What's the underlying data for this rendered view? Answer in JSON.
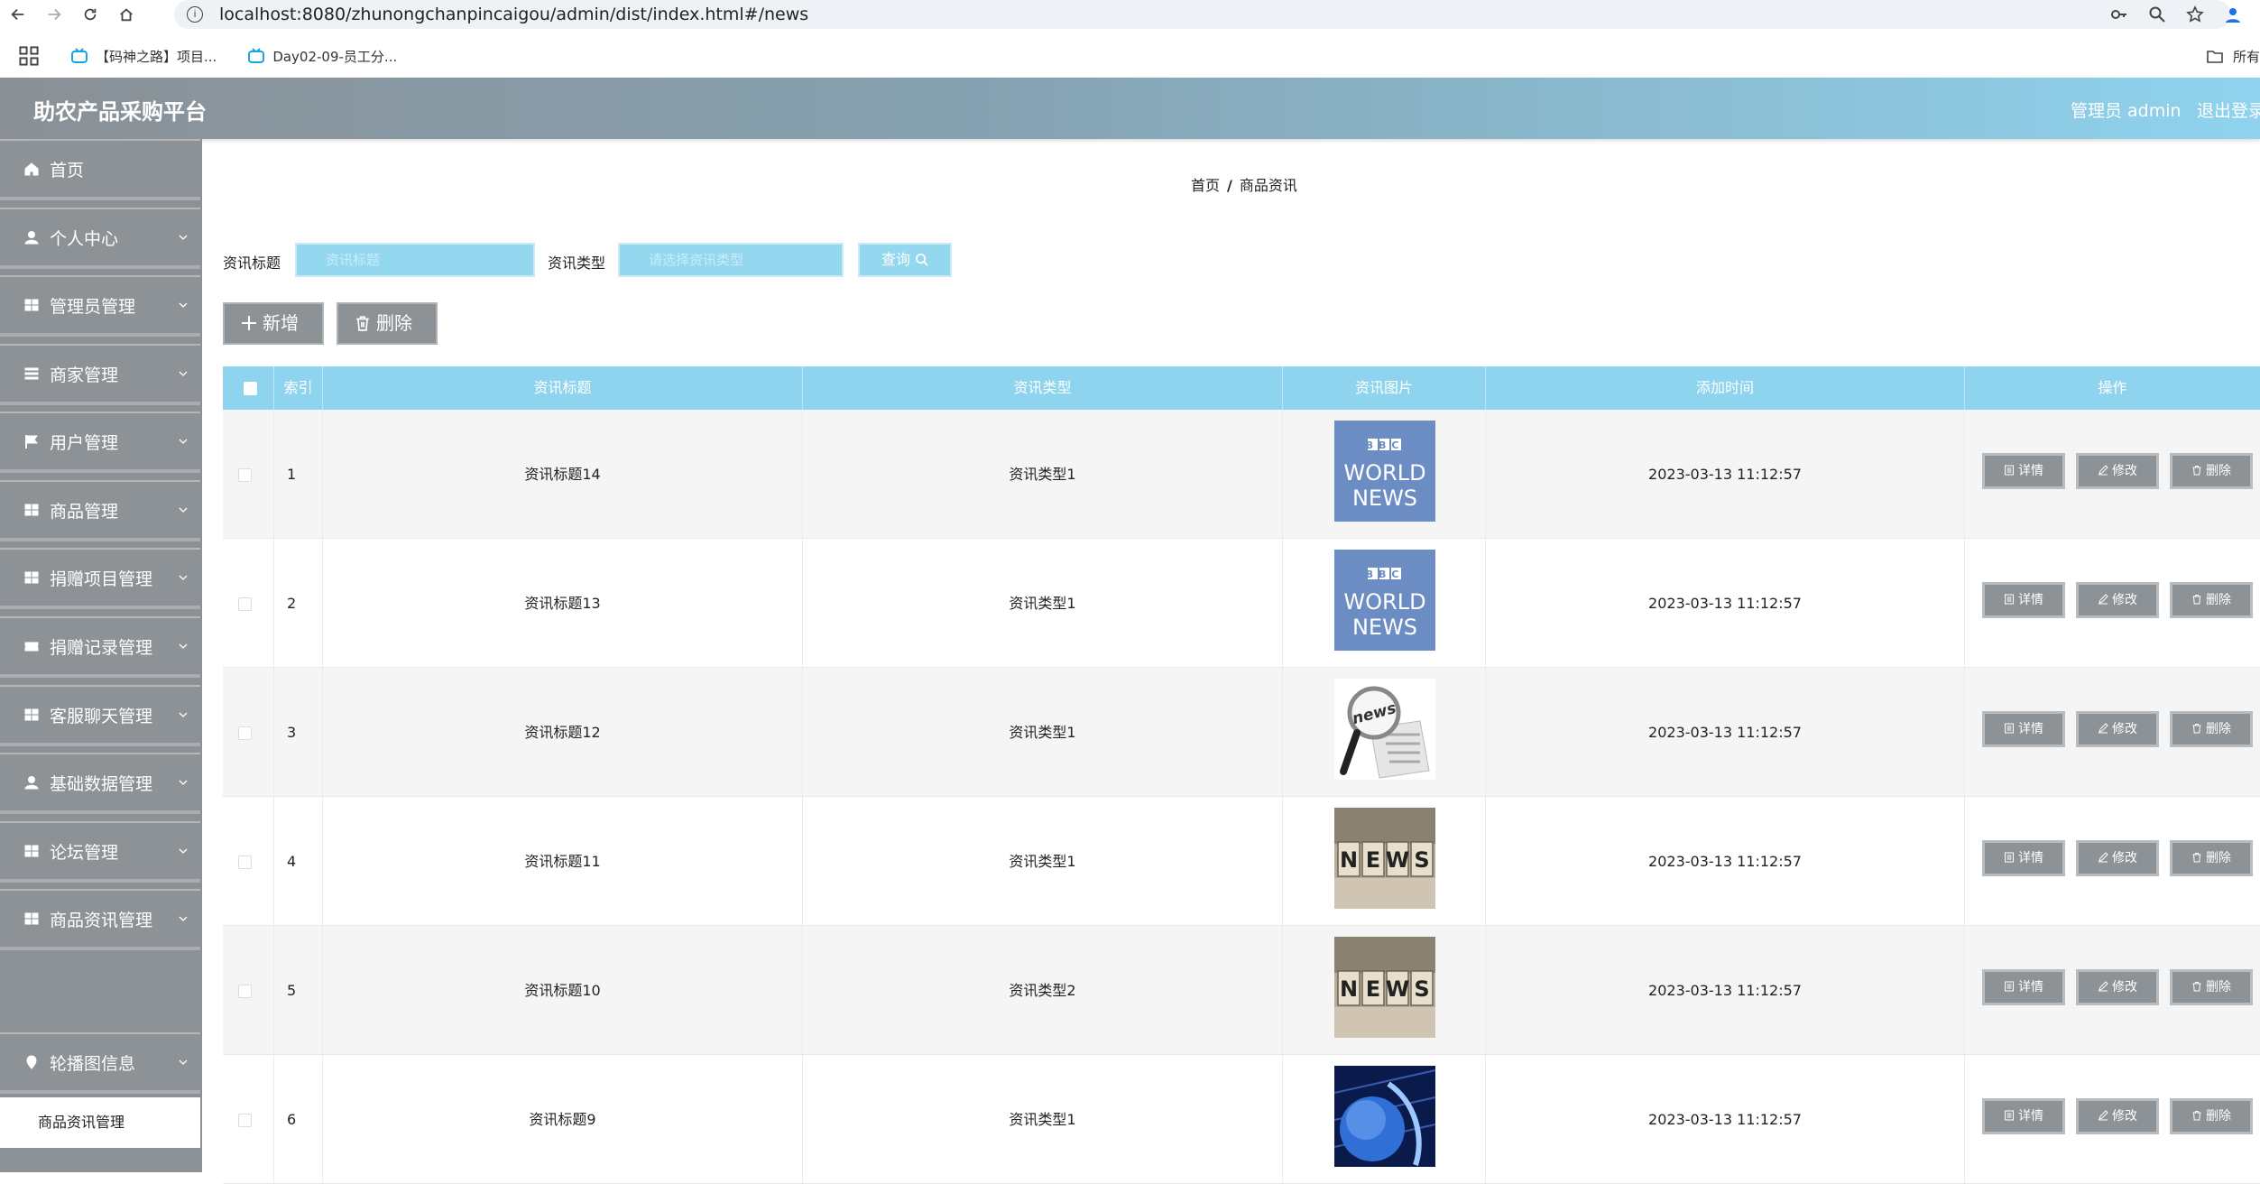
{
  "browser": {
    "url": "localhost:8080/zhunongchanpincaigou/admin/dist/index.html#/news",
    "bookmarks": [
      "【码神之路】项目...",
      "Day02-09-员工分..."
    ],
    "bookmarks_right": "所有"
  },
  "header": {
    "title": "助农产品采购平台",
    "user": "管理员 admin",
    "logout": "退出登录"
  },
  "sidebar": {
    "items": [
      {
        "label": "首页",
        "icon": "home-icon",
        "has_chevron": false
      },
      {
        "label": "个人中心",
        "icon": "user-icon",
        "has_chevron": true
      },
      {
        "label": "管理员管理",
        "icon": "grid-icon",
        "has_chevron": true
      },
      {
        "label": "商家管理",
        "icon": "list-icon",
        "has_chevron": true
      },
      {
        "label": "用户管理",
        "icon": "flag-icon",
        "has_chevron": true
      },
      {
        "label": "商品管理",
        "icon": "grid-icon",
        "has_chevron": true
      },
      {
        "label": "捐赠项目管理",
        "icon": "grid-icon",
        "has_chevron": true
      },
      {
        "label": "捐赠记录管理",
        "icon": "ticket-icon",
        "has_chevron": true
      },
      {
        "label": "客服聊天管理",
        "icon": "grid-icon",
        "has_chevron": true
      },
      {
        "label": "基础数据管理",
        "icon": "user-icon",
        "has_chevron": true
      },
      {
        "label": "论坛管理",
        "icon": "grid-icon",
        "has_chevron": true
      },
      {
        "label": "商品资讯管理",
        "icon": "grid-icon",
        "has_chevron": true
      },
      {
        "label": "轮播图信息",
        "icon": "pin-icon",
        "has_chevron": true
      }
    ],
    "submenu_label": "商品资讯管理"
  },
  "breadcrumb": {
    "home": "首页",
    "separator": "/",
    "current": "商品资讯"
  },
  "search": {
    "title_label": "资讯标题",
    "title_placeholder": "资讯标题",
    "type_label": "资讯类型",
    "type_placeholder": "请选择资讯类型",
    "button": "查询"
  },
  "actions": {
    "add": "新增",
    "delete": "删除"
  },
  "table": {
    "columns": [
      "索引",
      "资讯标题",
      "资讯类型",
      "资讯图片",
      "添加时间",
      "操作"
    ],
    "row_buttons": {
      "detail": "详情",
      "edit": "修改",
      "delete": "删除"
    },
    "rows": [
      {
        "index": "1",
        "title": "资讯标题14",
        "type": "资讯类型1",
        "image": "bbc-world-news",
        "time": "2023-03-13 11:12:57"
      },
      {
        "index": "2",
        "title": "资讯标题13",
        "type": "资讯类型1",
        "image": "bbc-world-news",
        "time": "2023-03-13 11:12:57"
      },
      {
        "index": "3",
        "title": "资讯标题12",
        "type": "资讯类型1",
        "image": "news-magnifier",
        "time": "2023-03-13 11:12:57"
      },
      {
        "index": "4",
        "title": "资讯标题11",
        "type": "资讯类型1",
        "image": "news-blocks",
        "time": "2023-03-13 11:12:57"
      },
      {
        "index": "5",
        "title": "资讯标题10",
        "type": "资讯类型2",
        "image": "news-blocks",
        "time": "2023-03-13 11:12:57"
      },
      {
        "index": "6",
        "title": "资讯标题9",
        "type": "资讯类型1",
        "image": "globe-news",
        "time": "2023-03-13 11:12:57"
      }
    ]
  },
  "image_text": {
    "bbc_logo": "BBC",
    "bbc_line1": "WORLD",
    "bbc_line2": "NEWS",
    "magnifier": "news",
    "blocks": [
      "N",
      "E",
      "W",
      "S"
    ]
  },
  "colors": {
    "accent": "#8fd4ef",
    "sidebar": "#8d9297",
    "button": "#8d9297"
  }
}
